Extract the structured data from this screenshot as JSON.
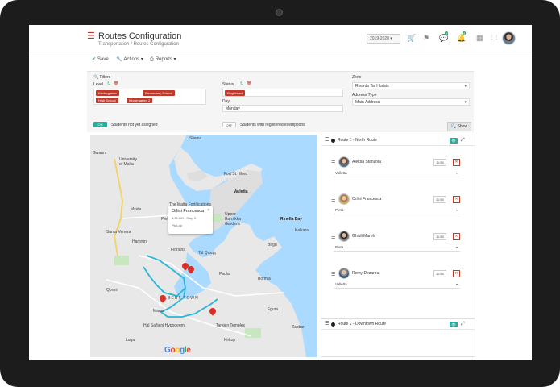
{
  "header": {
    "title": "Routes Configuration",
    "breadcrumb": "Transportation / Routes Configuration",
    "school_year": "2019-2020",
    "notification_count": "4",
    "message_count": "2"
  },
  "toolbar": {
    "save_label": "Save",
    "actions_label": "Actions",
    "reports_label": "Reports"
  },
  "filters": {
    "section_label": "Filters",
    "level_label": "Level",
    "level_chips": [
      "Kindergarten",
      "Elementary School",
      "High School",
      "Kindergarten 2"
    ],
    "status_label": "Status",
    "status_chip": "Registered",
    "day_label": "Day",
    "day_value": "Monday",
    "zone_label": "Zone",
    "zone_value": "Rivardo Tal Hudsis",
    "address_type_label": "Address Type",
    "address_type_value": "Main Address",
    "toggle_on_label": "ON",
    "toggle_on_text": "Students not yet assigned",
    "toggle_off_label": "OFF",
    "toggle_off_text": "Students with registered exemptions",
    "show_label": "Show"
  },
  "map": {
    "labels": {
      "gwann": "Gwann",
      "university": "University\nof Malta",
      "sliema": "Sliema",
      "fort": "Fort St. Elmo",
      "valletta": "Valletta",
      "msida": "Msida",
      "pieta": "Pieta",
      "floriana": "Floriana",
      "upper_barrakka": "Upper\nBarrakka\nGardens",
      "marsa": "Marsa",
      "paola": "Paola",
      "fgura": "Fgura",
      "zabbar": "Zabbar",
      "tarxien": "Tarxien Temples",
      "hal_saflieni": "Hal Saflieni Hypogeum",
      "kalkara": "Kalkara",
      "bormla": "Bormla",
      "birgu": "Birgu",
      "luqa": "Luqa",
      "hamrun": "Hamrun",
      "kirkop": "Kirkop",
      "albert_town": "ALBERT TOWN",
      "fortifications": "The Malta Fortifications",
      "rinella": "Rinella Bay",
      "tal_qroqq": "Tal Qroqq",
      "santa_venera": "Santa Venera",
      "qormi": "Qormi"
    },
    "info": {
      "name": "Orlini Francesca",
      "line1": "8:00 AM - Stop 3",
      "line2": "Pick-up"
    },
    "google_letters": [
      "G",
      "o",
      "o",
      "g",
      "l",
      "e"
    ]
  },
  "routes": [
    {
      "title": "Route 1 - North Route",
      "stops": [
        {
          "name": "Aleksa Stanzola",
          "time": "11:55",
          "option": "Valletta"
        },
        {
          "name": "Orlini Francesca",
          "time": "11:55",
          "option": "Pieta"
        },
        {
          "name": "Ghiuli Maroh",
          "time": "11:55",
          "option": "Pieta"
        },
        {
          "name": "Remy Dezarou",
          "time": "11:55",
          "option": "Valletta"
        }
      ]
    },
    {
      "title": "Route 2 - Downtown Route",
      "stops": []
    }
  ],
  "colors": {
    "accent": "#c0392b",
    "teal": "#2eaa9a",
    "water": "#aadaff",
    "route": "#29b6d8",
    "pin": "#d93025",
    "toolbar_green": "#27ae60"
  }
}
